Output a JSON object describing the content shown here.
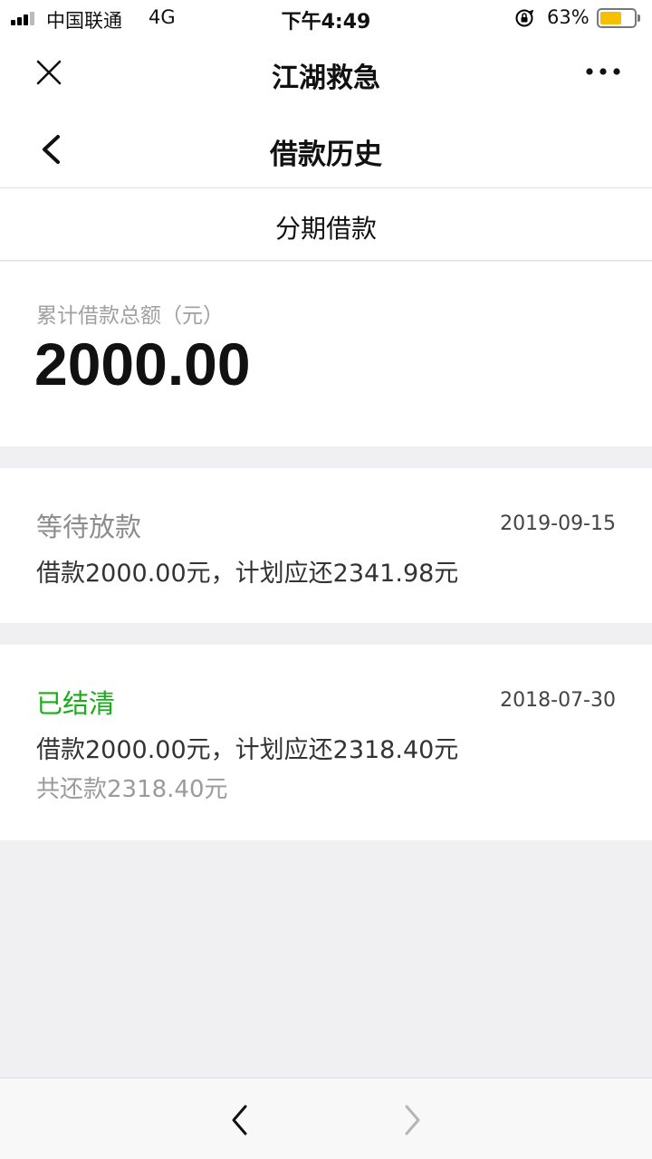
{
  "status_bar": {
    "carrier": "中国联通",
    "network": "4G",
    "time": "下午4:49",
    "battery_percent_text": "63%",
    "battery_level": 0.63,
    "icons": [
      "signal-icon",
      "orientation-lock-icon",
      "battery-icon"
    ]
  },
  "top_bar": {
    "title": "江湖救急",
    "close_icon": "close-icon",
    "more_icon": "more-icon"
  },
  "nav_bar": {
    "title": "借款历史",
    "back_icon": "chevron-left-icon"
  },
  "tab": {
    "label": "分期借款"
  },
  "summary": {
    "label": "累计借款总额（元）",
    "amount": "2000.00"
  },
  "loans": [
    {
      "status": "等待放款",
      "status_color": "#8c8c8c",
      "date": "2019-09-15",
      "detail": "借款2000.00元，计划应还2341.98元"
    },
    {
      "status": "已结清",
      "status_color": "#1aad19",
      "date": "2018-07-30",
      "detail": "借款2000.00元，计划应还2318.40元",
      "repaid": "共还款2318.40元"
    }
  ],
  "bottom_bar": {
    "back_icon": "chevron-left-icon",
    "forward_icon": "chevron-right-icon"
  },
  "colors": {
    "accent_green": "#1aad19",
    "background": "#f0f0f2",
    "battery": "#f5c000"
  }
}
